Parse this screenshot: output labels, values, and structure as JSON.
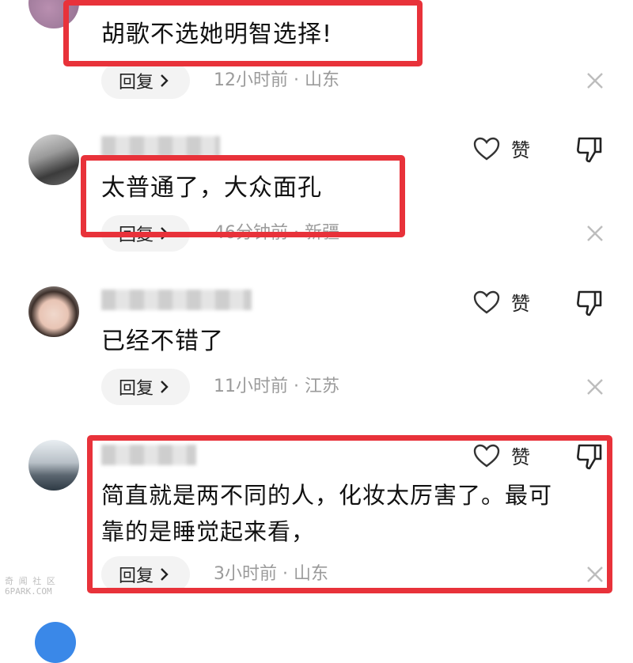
{
  "comments": [
    {
      "text": "胡歌不选她明智选择!",
      "reply_label": "回复",
      "meta": "12小时前 · 山东",
      "like_label": ""
    },
    {
      "text": "太普通了，大众面孔",
      "reply_label": "回复",
      "meta": "46分钟前 · 新疆",
      "like_label": "赞"
    },
    {
      "text": "已经不错了",
      "reply_label": "回复",
      "meta": "11小时前 · 江苏",
      "like_label": "赞"
    },
    {
      "text_line1": "简直就是两不同的人，化妆太厉害了。最可",
      "text_line2": "靠的是睡觉起来看，",
      "reply_label": "回复",
      "meta": "3小时前 · 山东",
      "like_label": "赞"
    }
  ],
  "watermark": {
    "line1": "奇 闻 社 区",
    "line2": "6PARK.COM"
  },
  "colors": {
    "highlight_box": "#e8323a",
    "meta_text": "#9b9b9b",
    "reply_bg": "#f3f3f3"
  },
  "icons": [
    "heart-outline-icon",
    "thumbs-down-icon",
    "close-icon",
    "chevron-right-icon"
  ]
}
